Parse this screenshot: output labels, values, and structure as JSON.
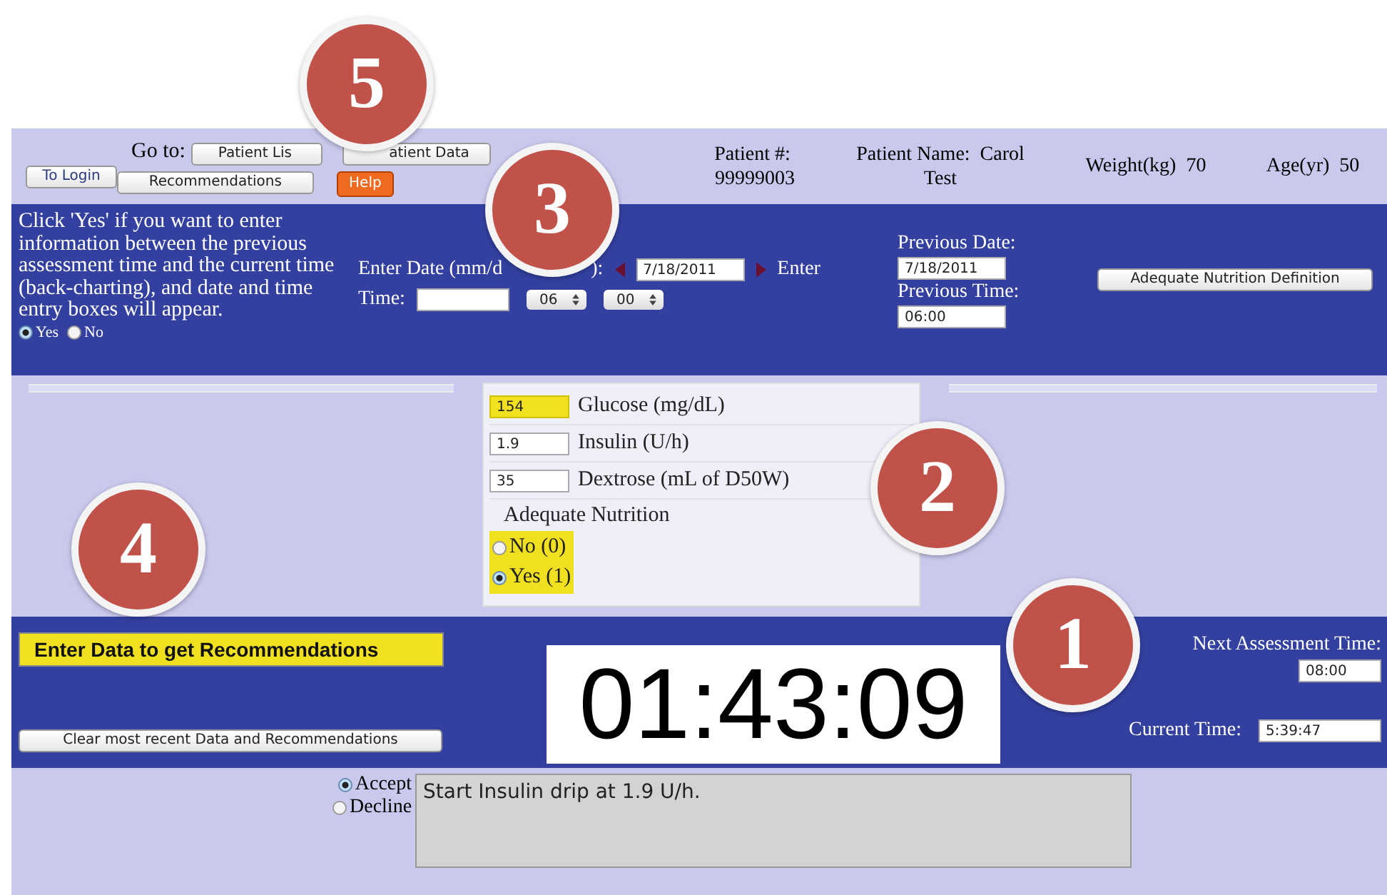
{
  "header": {
    "login_button": "To Login",
    "goto_label": "Go to:",
    "nav_row_1": [
      "Patient Lis",
      "atient Data"
    ],
    "nav_row_2": [
      "Recommendations"
    ],
    "help_button": "Help",
    "patient": [
      {
        "label": "Patient #:",
        "value": "99999003"
      },
      {
        "label": "Patient Name:",
        "value": "Carol Test"
      },
      {
        "label": "Weight(kg)",
        "value": "70"
      },
      {
        "label": "Age(yr)",
        "value": "50"
      }
    ]
  },
  "backchart": {
    "instructions": "Click 'Yes' if you want to enter information between the previous assessment time and the current time (back-charting), and date and time entry boxes will appear.",
    "options": [
      {
        "label": "Yes",
        "selected": true
      },
      {
        "label": "No",
        "selected": false
      }
    ],
    "date_label_start": "Enter Date (mm/d",
    "date_label_end": "):",
    "date": "7/18/2011",
    "enter": "Enter",
    "time_label": "Time:",
    "hour": "06",
    "minute": "00",
    "previous_date_label": "Previous Date:",
    "previous_date": "7/18/2011",
    "previous_time_label": "Previous Time:",
    "previous_time": "06:00",
    "nutrition_button": "Adequate Nutrition Definition"
  },
  "entries": [
    {
      "value": "154",
      "label": "Glucose (mg/dL)",
      "highlighted": true
    },
    {
      "value": "1.9",
      "label": "Insulin (U/h)",
      "highlighted": false
    },
    {
      "value": "35",
      "label": "Dextrose (mL of D50W)",
      "highlighted": false
    }
  ],
  "nutrition": {
    "label": "Adequate Nutrition",
    "options": [
      {
        "label": "No (0)",
        "selected": false
      },
      {
        "label": "Yes (1)",
        "selected": true
      }
    ]
  },
  "status": {
    "banner": "Enter Data to get Recommendations",
    "clear_button": "Clear most recent Data and Recommendations",
    "timer": "01:43:09",
    "next_label": "Next Assessment Time:",
    "next_time": "08:00",
    "current_label": "Current Time:",
    "current_time": "5:39:47"
  },
  "recommendation": {
    "options": [
      {
        "label": "Accept",
        "selected": true
      },
      {
        "label": "Decline",
        "selected": false
      }
    ],
    "text": "Start Insulin drip at 1.9 U/h."
  },
  "callouts": [
    {
      "number": "5"
    },
    {
      "number": "3"
    },
    {
      "number": "2"
    },
    {
      "number": "4"
    },
    {
      "number": "1"
    }
  ]
}
